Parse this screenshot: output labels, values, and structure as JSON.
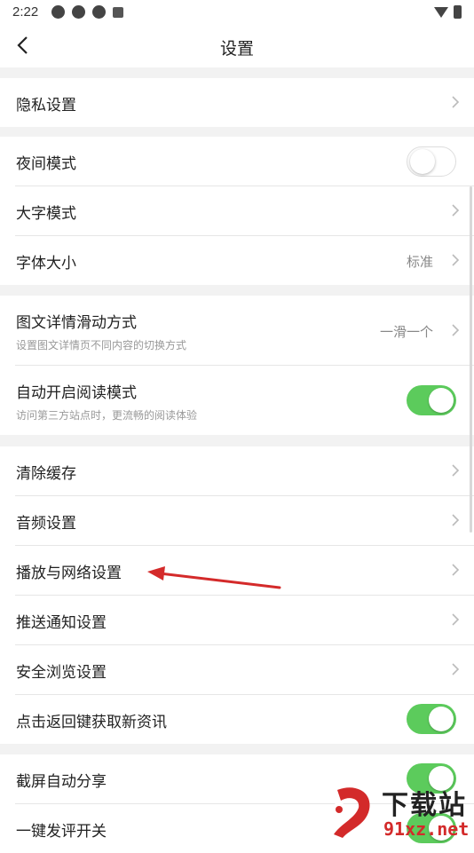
{
  "status_bar": {
    "time": "2:22"
  },
  "header": {
    "title": "设置"
  },
  "groups": [
    {
      "rows": [
        {
          "label": "隐私设置",
          "control": "chevron"
        }
      ]
    },
    {
      "rows": [
        {
          "label": "夜间模式",
          "control": "toggle",
          "on": false
        },
        {
          "label": "大字模式",
          "control": "chevron"
        },
        {
          "label": "字体大小",
          "value": "标准",
          "control": "chevron"
        }
      ]
    },
    {
      "rows": [
        {
          "label": "图文详情滑动方式",
          "sub": "设置图文详情页不同内容的切换方式",
          "value": "一滑一个",
          "control": "chevron"
        },
        {
          "label": "自动开启阅读模式",
          "sub": "访问第三方站点时，更流畅的阅读体验",
          "control": "toggle",
          "on": true
        }
      ]
    },
    {
      "rows": [
        {
          "label": "清除缓存",
          "control": "chevron"
        },
        {
          "label": "音频设置",
          "control": "chevron"
        },
        {
          "label": "播放与网络设置",
          "control": "chevron"
        },
        {
          "label": "推送通知设置",
          "control": "chevron"
        },
        {
          "label": "安全浏览设置",
          "control": "chevron"
        },
        {
          "label": "点击返回键获取新资讯",
          "control": "toggle",
          "on": true
        }
      ]
    },
    {
      "rows": [
        {
          "label": "截屏自动分享",
          "control": "toggle",
          "on": true
        },
        {
          "label": "一键发评开关",
          "control": "toggle",
          "on": true
        }
      ]
    }
  ],
  "watermark": {
    "text": "下载站",
    "url": "91xz.net"
  },
  "colors": {
    "toggle_on": "#5ccb5c",
    "annotation_arrow": "#d42a2a",
    "watermark_red": "#d32a2a"
  }
}
